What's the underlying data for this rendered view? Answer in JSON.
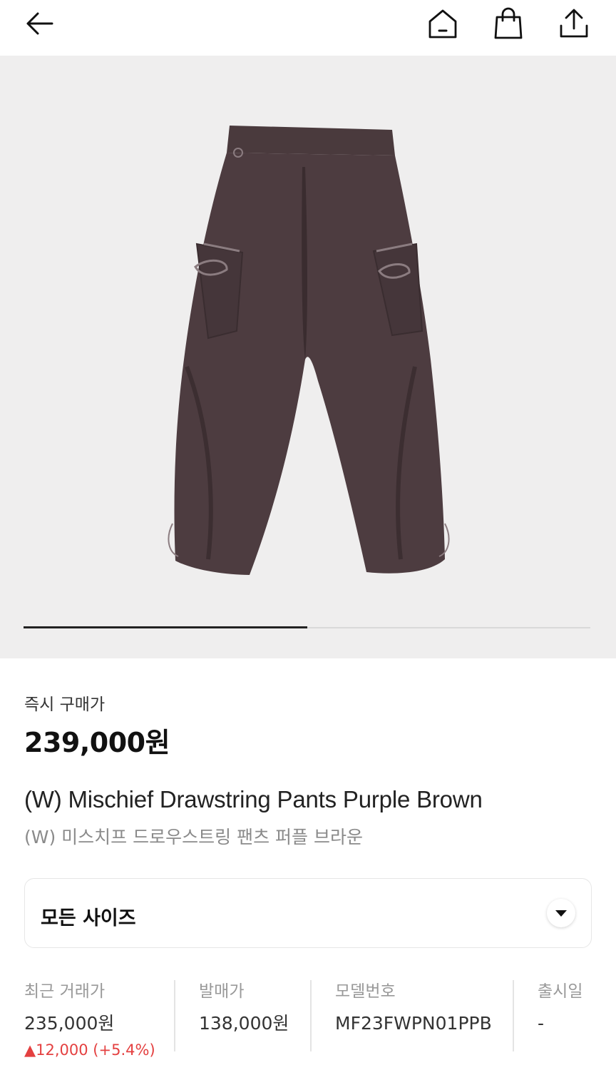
{
  "header": {
    "icons": [
      "back-arrow-icon",
      "home-icon",
      "shopping-bag-icon",
      "share-icon"
    ]
  },
  "product_image": {
    "slider_progress": 0.5
  },
  "purchase": {
    "label": "즉시 구매가",
    "price": "239,000원"
  },
  "product": {
    "name_en": "(W) Mischief Drawstring Pants Purple Brown",
    "name_ko": "(W) 미스치프 드로우스트링 팬츠 퍼플 브라운"
  },
  "size_select": {
    "label": "모든 사이즈"
  },
  "info": {
    "recent_trade": {
      "label": "최근 거래가",
      "value": "235,000원",
      "change": "▲12,000 (+5.4%)"
    },
    "release_price": {
      "label": "발매가",
      "value": "138,000원"
    },
    "model_number": {
      "label": "모델번호",
      "value": "MF23FWPN01PPB"
    },
    "release_date": {
      "label": "출시일",
      "value": "-"
    }
  },
  "colors": {
    "accent_down": "#e44040",
    "product_color": "#4b3b3e"
  }
}
